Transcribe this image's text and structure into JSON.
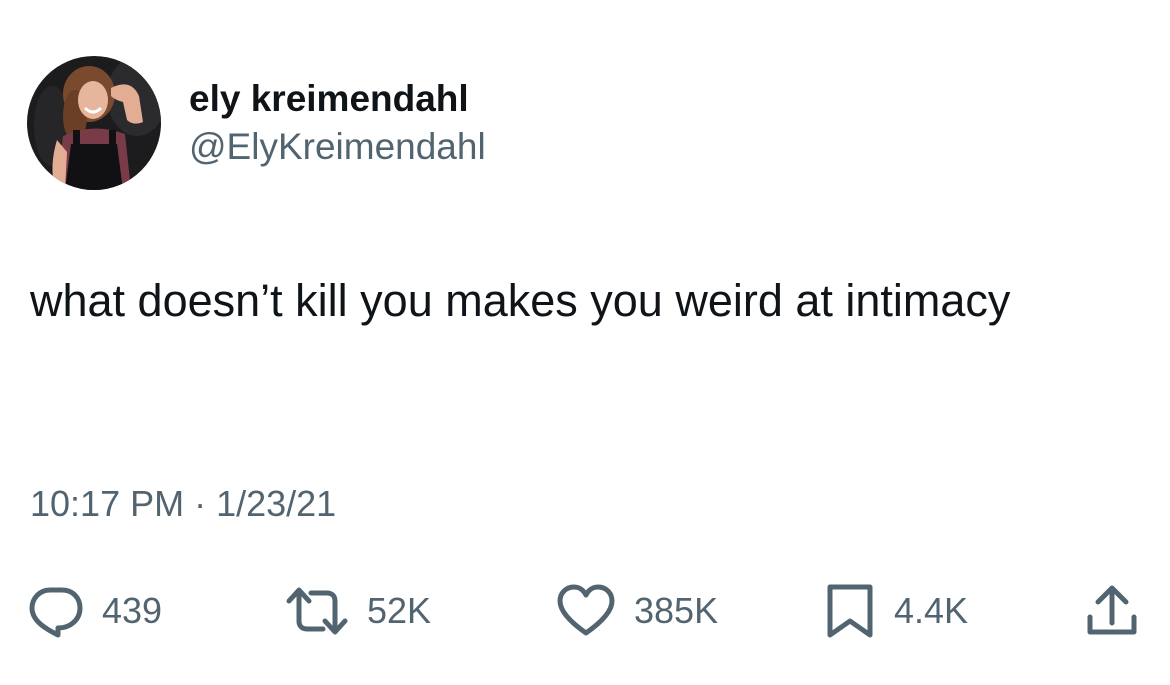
{
  "author": {
    "display_name": "ely kreimendahl",
    "handle": "@ElyKreimendahl",
    "avatar_icon": "profile-photo"
  },
  "tweet": {
    "text": "what doesn’t kill you makes you weird at intimacy",
    "time": "10:17 PM",
    "separator": "·",
    "date": "1/23/21"
  },
  "actions": {
    "reply": {
      "icon": "speech-bubble-icon",
      "count": "439"
    },
    "retweet": {
      "icon": "retweet-arrows-icon",
      "count": "52K"
    },
    "like": {
      "icon": "heart-icon",
      "count": "385K"
    },
    "bookmark": {
      "icon": "bookmark-icon",
      "count": "4.4K"
    },
    "share": {
      "icon": "share-upload-icon"
    }
  },
  "colors": {
    "text_primary": "#0f1419",
    "text_secondary": "#536471",
    "background": "#ffffff"
  }
}
